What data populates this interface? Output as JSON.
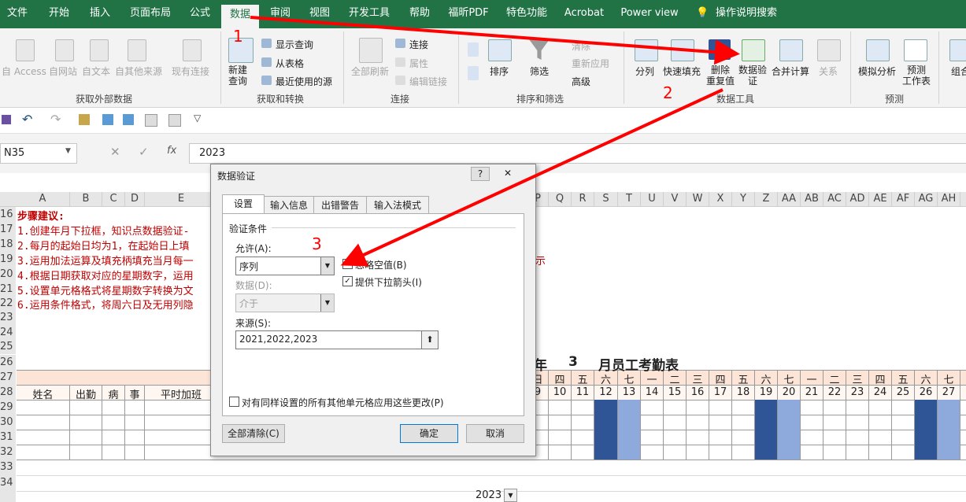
{
  "tabs": [
    "文件",
    "开始",
    "插入",
    "页面布局",
    "公式",
    "数据",
    "审阅",
    "视图",
    "开发工具",
    "帮助",
    "福昕PDF",
    "特色功能",
    "Acrobat",
    "Power view",
    "操作说明搜索"
  ],
  "ribbon": {
    "get_external": {
      "items": [
        "自 Access",
        "自网站",
        "自文本",
        "自其他来源",
        "现有连接"
      ],
      "group": "获取外部数据"
    },
    "transform": {
      "new_query": "新建\n查询",
      "show_query": "显示查询",
      "from_table": "从表格",
      "recent_sources": "最近使用的源",
      "group": "获取和转换"
    },
    "connections": {
      "refresh_all": "全部刷新",
      "connections": "连接",
      "properties": "属性",
      "edit_links": "编辑链接",
      "group": "连接"
    },
    "sort_filter": {
      "sort": "排序",
      "filter": "筛选",
      "clear": "清除",
      "reapply": "重新应用",
      "advanced": "高级",
      "group": "排序和筛选"
    },
    "data_tools": {
      "split": "分列",
      "flash_fill": "快速填充",
      "remove_dup": "删除\n重复值",
      "validation": "数据验\n证",
      "consolidate": "合并计算",
      "relations": "关系",
      "group": "数据工具"
    },
    "forecast": {
      "whatif": "模拟分析",
      "sheet": "预测\n工作表",
      "group": "预测"
    },
    "outline": {
      "group_btn": "组合"
    }
  },
  "formula_bar": {
    "name_box": "N35",
    "value": "2023"
  },
  "columns": [
    "A",
    "B",
    "C",
    "D",
    "E",
    "P",
    "Q",
    "R",
    "S",
    "T",
    "U",
    "V",
    "W",
    "X",
    "Y",
    "Z",
    "AA",
    "AB",
    "AC",
    "AD",
    "AE",
    "AF",
    "AG",
    "AH"
  ],
  "rows": [
    "16",
    "17",
    "18",
    "19",
    "20",
    "21",
    "22",
    "23",
    "24",
    "25",
    "26",
    "27",
    "28",
    "29",
    "30",
    "31",
    "32",
    "33",
    "34"
  ],
  "notes": {
    "title": "步骤建议:",
    "lines": [
      "1.创建年月下拉框，知识点数据验证-",
      "2.每月的起始日均为1，在起始日上填",
      "3.运用加法运算及填充柄填充当月每一",
      "4.根据日期获取对应的星期数字，运用",
      "5.设置单元格格式将星期数字转换为文",
      "6.运用条件格式，将周六日及无用列隐"
    ],
    "overflow": "示"
  },
  "sheet_title": {
    "year_suffix": "年",
    "month": "3",
    "title": "月员工考勤表"
  },
  "weekdays": [
    "日",
    "四",
    "五",
    "六",
    "七",
    "一",
    "二",
    "三",
    "四",
    "五",
    "六",
    "七",
    "一",
    "二",
    "三",
    "四",
    "五",
    "六",
    "七"
  ],
  "dates": [
    "9",
    "10",
    "11",
    "12",
    "13",
    "14",
    "15",
    "16",
    "17",
    "18",
    "19",
    "20",
    "21",
    "22",
    "23",
    "24",
    "25",
    "26",
    "27"
  ],
  "headers28": [
    "姓名",
    "出勤",
    "病",
    "事",
    "平时加班"
  ],
  "year_cell": "2023",
  "dialog": {
    "title": "数据验证",
    "help": "?",
    "close": "✕",
    "tabs": [
      "设置",
      "输入信息",
      "出错警告",
      "输入法模式"
    ],
    "section": "验证条件",
    "allow_label": "允许(A):",
    "allow_value": "序列",
    "ignore_blank": "忽略空值(B)",
    "dropdown_arrow": "提供下拉箭头(I)",
    "data_label": "数据(D):",
    "data_value": "介于",
    "source_label": "来源(S):",
    "source_value": "2021,2022,2023",
    "apply_all": "对有同样设置的所有其他单元格应用这些更改(P)",
    "clear_all": "全部清除(C)",
    "ok": "确定",
    "cancel": "取消"
  },
  "annotations": [
    "1",
    "2",
    "3"
  ],
  "colors": {
    "ribbon_green": "#217346",
    "weekend_dark": "#2f5597",
    "weekend_light": "#8ea9db",
    "note_red": "#c00000",
    "arrow_red": "#ff0000",
    "header_peach": "#fce4d6"
  }
}
